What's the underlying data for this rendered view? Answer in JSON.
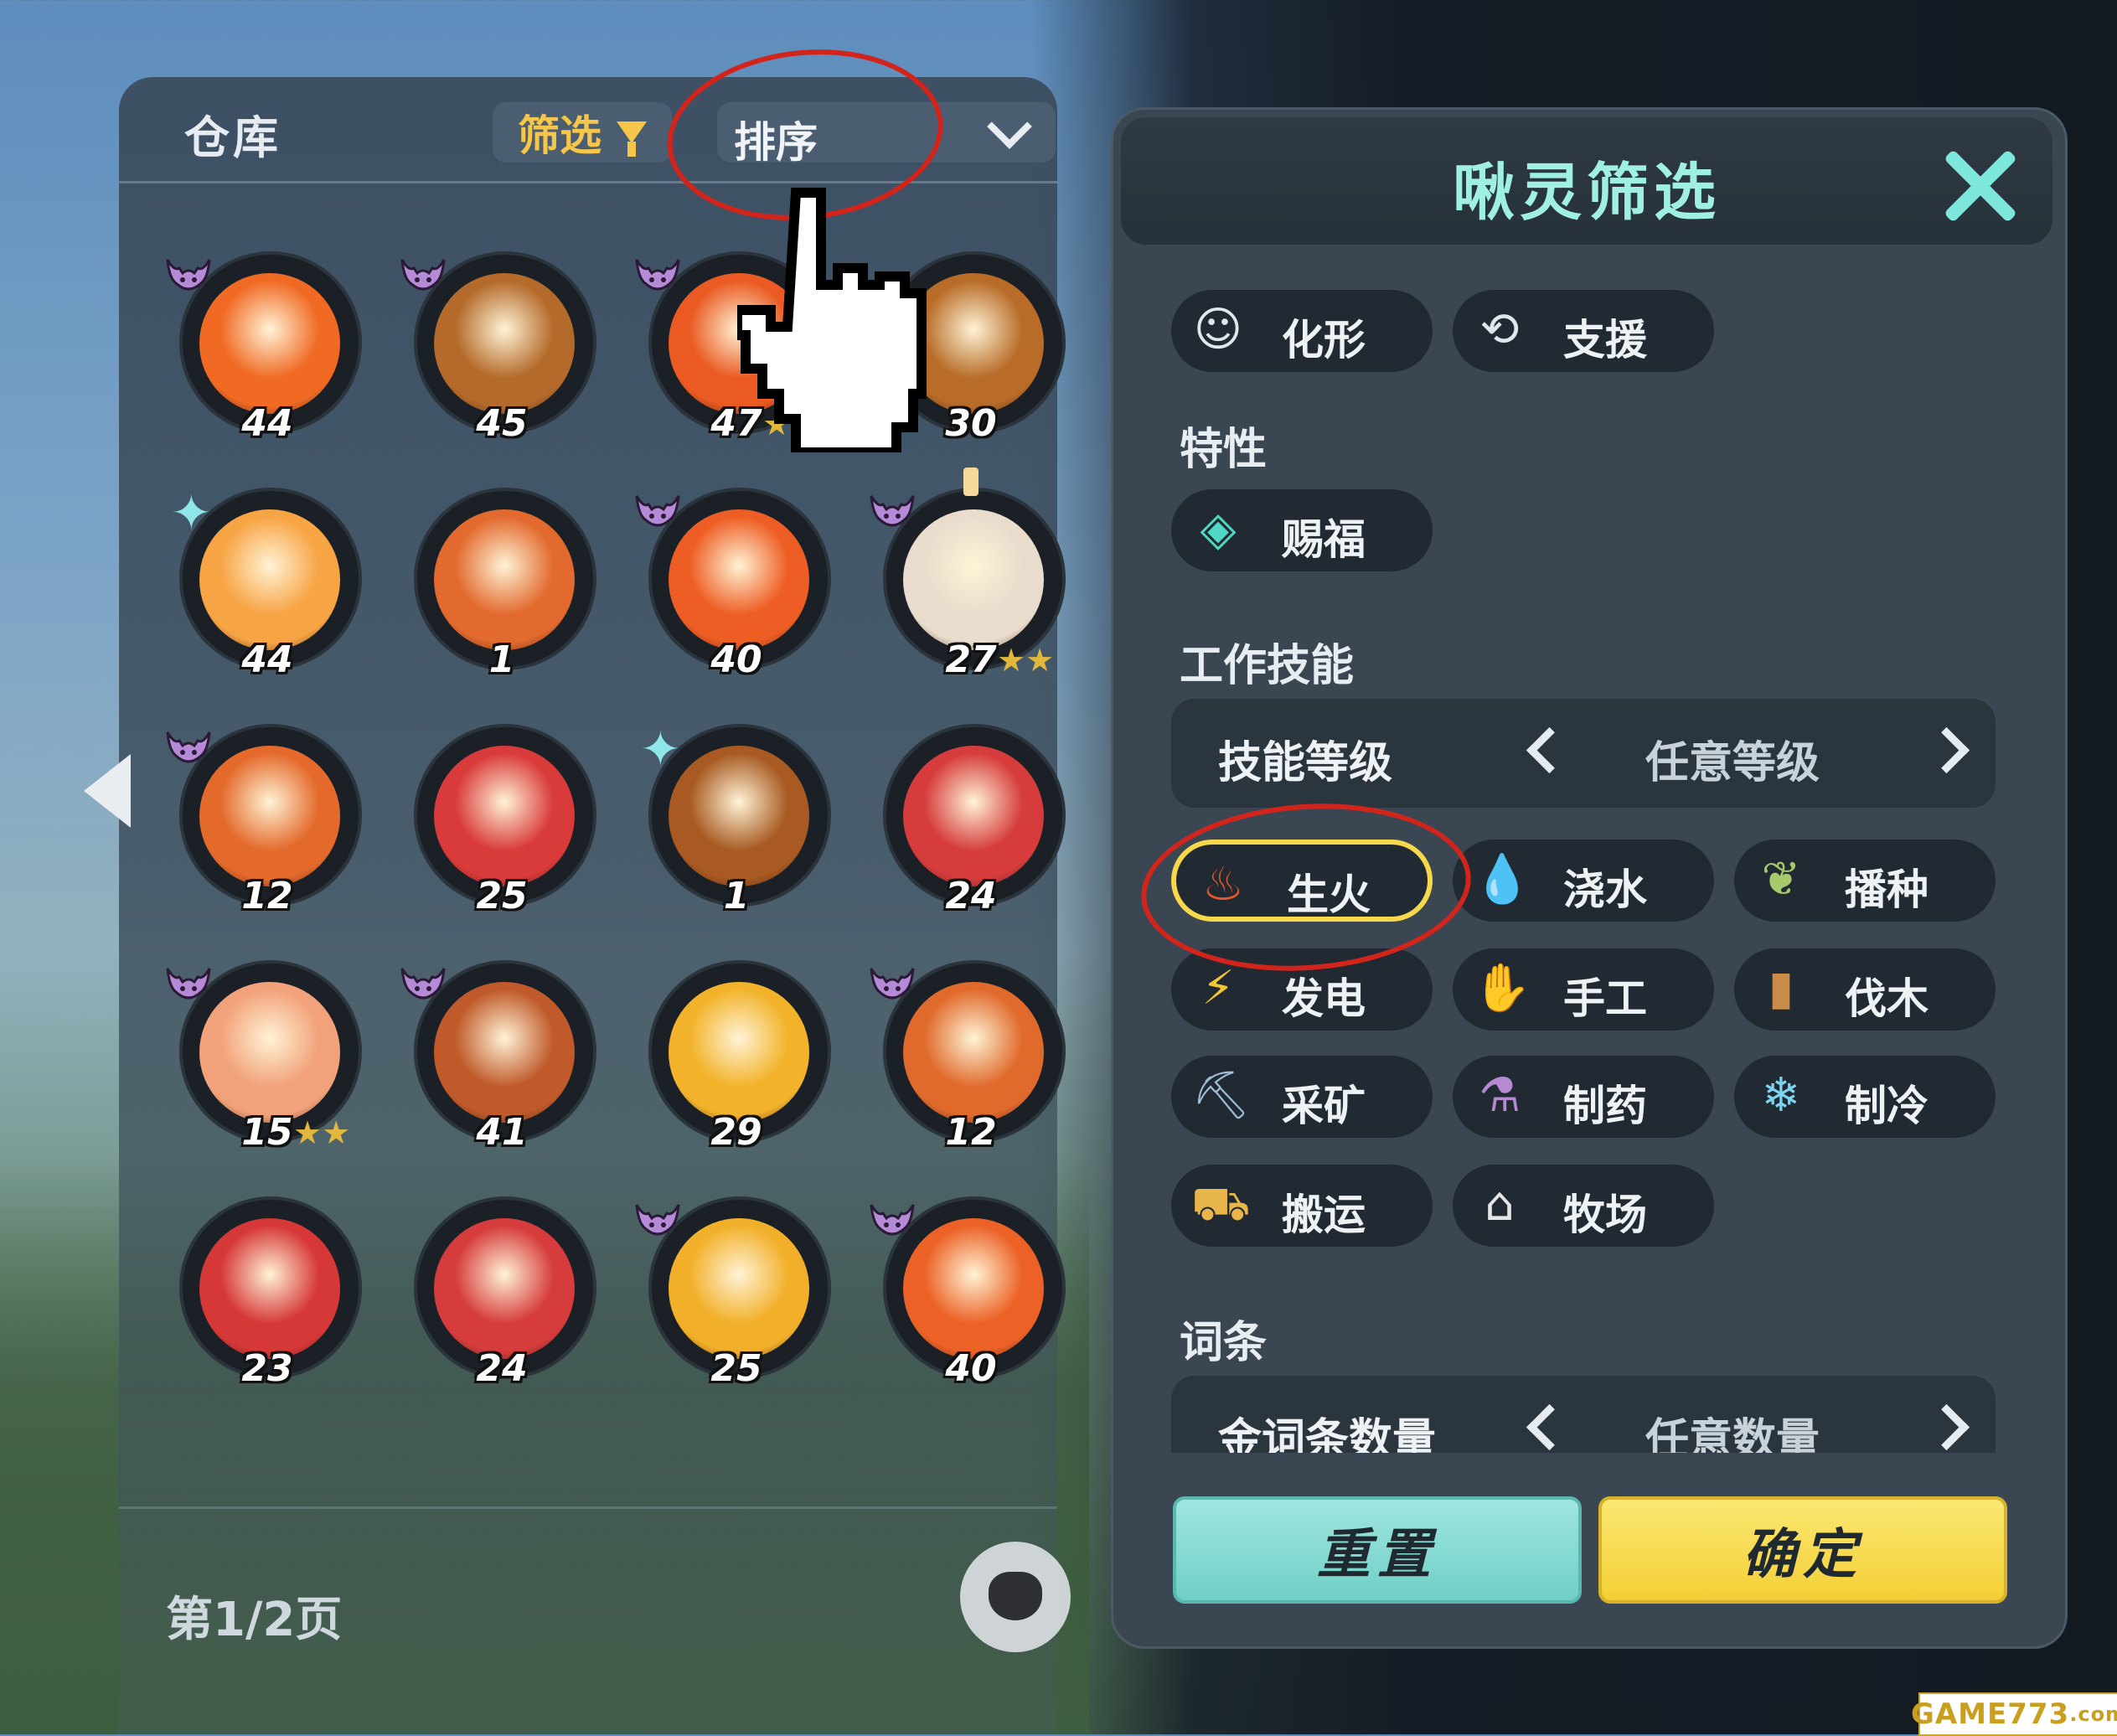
{
  "storage": {
    "title": "仓库",
    "filter_label": "筛选",
    "sort_label": "排序",
    "page_indicator": "第1/2页"
  },
  "pals": [
    {
      "level": "44",
      "horn": true,
      "color": "#f06a24",
      "stars": ""
    },
    {
      "level": "45",
      "horn": true,
      "color": "#b46a2a",
      "stars": ""
    },
    {
      "level": "47",
      "horn": true,
      "color": "#ea5a22",
      "stars": "★"
    },
    {
      "level": "30",
      "horn": false,
      "color": "#b86c28",
      "stars": ""
    },
    {
      "level": "44",
      "horn": false,
      "spark": true,
      "color": "#f7a444",
      "stars": ""
    },
    {
      "level": "1",
      "horn": false,
      "color": "#e26a2e",
      "stars": ""
    },
    {
      "level": "40",
      "horn": true,
      "color": "#ee5e24",
      "stars": ""
    },
    {
      "level": "27",
      "horn": true,
      "candle": true,
      "color": "#e9dccc",
      "stars": "★★"
    },
    {
      "level": "12",
      "horn": true,
      "color": "#e46a2c",
      "stars": ""
    },
    {
      "level": "25",
      "horn": false,
      "color": "#d93a3a",
      "stars": ""
    },
    {
      "level": "1",
      "horn": false,
      "spark": true,
      "color": "#a85a22",
      "stars": ""
    },
    {
      "level": "24",
      "horn": false,
      "color": "#d63c3c",
      "stars": ""
    },
    {
      "level": "15",
      "horn": true,
      "color": "#f2a27a",
      "stars": "★★"
    },
    {
      "level": "41",
      "horn": true,
      "color": "#c05a2a",
      "stars": ""
    },
    {
      "level": "29",
      "horn": false,
      "color": "#f2b32a",
      "stars": ""
    },
    {
      "level": "12",
      "horn": true,
      "color": "#e06a2c",
      "stars": ""
    },
    {
      "level": "23",
      "horn": false,
      "color": "#d63838",
      "stars": ""
    },
    {
      "level": "24",
      "horn": false,
      "color": "#d63c3c",
      "stars": ""
    },
    {
      "level": "25",
      "horn": true,
      "color": "#f2b02a",
      "stars": ""
    },
    {
      "level": "40",
      "horn": true,
      "color": "#ec6226",
      "stars": ""
    }
  ],
  "dialog": {
    "title": "啾灵筛选",
    "top_chips": [
      {
        "label": "化形",
        "icon": "transform-icon",
        "glyph": "☺"
      },
      {
        "label": "支援",
        "icon": "support-icon",
        "glyph": "⟲"
      }
    ],
    "trait_section": "特性",
    "trait_chips": [
      {
        "label": "赐福",
        "icon": "blessing-icon",
        "glyph": "◈"
      }
    ],
    "work_section": "工作技能",
    "skill_level": {
      "label": "技能等级",
      "value": "任意等级"
    },
    "work_skills": [
      {
        "label": "生火",
        "icon": "fire-icon",
        "glyph": "♨",
        "color": "#e8582a",
        "selected": true
      },
      {
        "label": "浇水",
        "icon": "water-icon",
        "glyph": "💧",
        "color": "#5aa7e6",
        "selected": false
      },
      {
        "label": "播种",
        "icon": "sprout-icon",
        "glyph": "❦",
        "color": "#a6c96a",
        "selected": false
      },
      {
        "label": "发电",
        "icon": "electric-icon",
        "glyph": "⚡",
        "color": "#f2c733",
        "selected": false
      },
      {
        "label": "手工",
        "icon": "handcraft-icon",
        "glyph": "✋",
        "color": "#f0d9b8",
        "selected": false
      },
      {
        "label": "伐木",
        "icon": "lumber-icon",
        "glyph": "▮",
        "color": "#c98a4a",
        "selected": false
      },
      {
        "label": "采矿",
        "icon": "pickaxe-icon",
        "glyph": "⛏",
        "color": "#9fbfd6",
        "selected": false
      },
      {
        "label": "制药",
        "icon": "medicine-icon",
        "glyph": "⚗",
        "color": "#b68ad2",
        "selected": false
      },
      {
        "label": "制冷",
        "icon": "snowflake-icon",
        "glyph": "❄",
        "color": "#7fd3f0",
        "selected": false
      },
      {
        "label": "搬运",
        "icon": "cart-icon",
        "glyph": "⛟",
        "color": "#e8b54a",
        "selected": false
      },
      {
        "label": "牧场",
        "icon": "ranch-icon",
        "glyph": "⌂",
        "color": "#e6e6e6",
        "selected": false
      }
    ],
    "entry_section": "词条",
    "gold_entries": {
      "label": "金词条数量",
      "value": "任意数量"
    },
    "reset_label": "重置",
    "confirm_label": "确定"
  },
  "watermark": {
    "text": "GAME773",
    "suffix": ".com"
  }
}
